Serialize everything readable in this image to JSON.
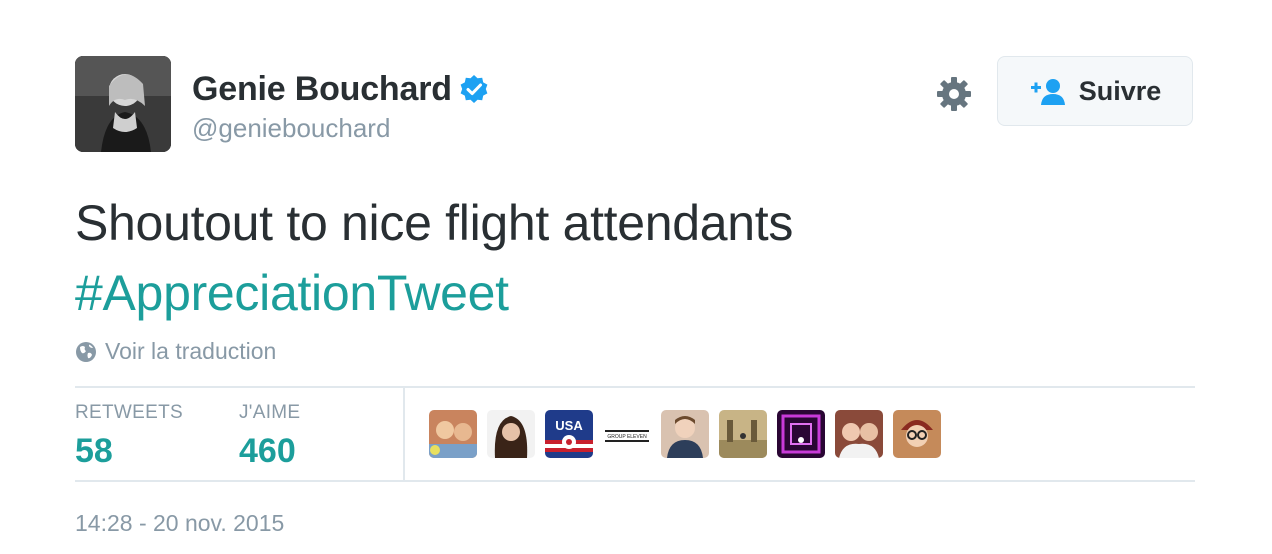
{
  "user": {
    "name": "Genie Bouchard",
    "handle": "@geniebouchard",
    "verified": true,
    "avatar_icon": "user-photo"
  },
  "actions": {
    "settings_icon": "gear-icon",
    "follow_label": "Suivre",
    "follow_icon": "add-user-icon"
  },
  "tweet": {
    "text": "Shoutout to nice flight attendants",
    "hashtag": "#AppreciationTweet"
  },
  "translate": {
    "label": "Voir la traduction",
    "icon": "globe-icon"
  },
  "stats": {
    "retweets_label": "RETWEETS",
    "retweets_value": "58",
    "likes_label": "J'AIME",
    "likes_value": "460"
  },
  "likers": [
    {
      "name": "liker-avatar-1",
      "bg": "#c9845e"
    },
    {
      "name": "liker-avatar-2",
      "bg": "#5a3a2e"
    },
    {
      "name": "liker-avatar-3",
      "bg": "#1f3b8a",
      "text": "USA"
    },
    {
      "name": "liker-avatar-4",
      "bg": "#ffffff",
      "text": "GROUP ELEVEN"
    },
    {
      "name": "liker-avatar-5",
      "bg": "#d9c2b0"
    },
    {
      "name": "liker-avatar-6",
      "bg": "#b9a070"
    },
    {
      "name": "liker-avatar-7",
      "bg": "#8a1fa3"
    },
    {
      "name": "liker-avatar-8",
      "bg": "#a35a3e"
    },
    {
      "name": "liker-avatar-9",
      "bg": "#c58a5a"
    }
  ],
  "timestamp": "14:28 - 20 nov. 2015",
  "colors": {
    "accent": "#1c9e9b",
    "verified": "#1da1f2",
    "muted": "#8899a6",
    "text": "#292f33"
  }
}
